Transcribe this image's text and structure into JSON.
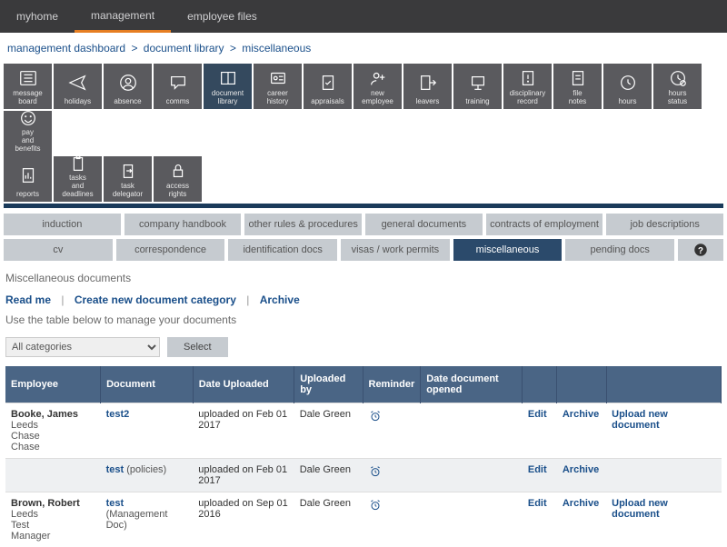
{
  "top_nav": {
    "items": [
      {
        "label": "myhome",
        "active": false
      },
      {
        "label": "management",
        "active": true
      },
      {
        "label": "employee files",
        "active": false
      }
    ]
  },
  "breadcrumb": {
    "parts": [
      "management dashboard",
      "document library",
      "miscellaneous"
    ]
  },
  "tiles": {
    "row1": [
      {
        "label": "message board",
        "icon": "list"
      },
      {
        "label": "holidays",
        "icon": "plane"
      },
      {
        "label": "absence",
        "icon": "user-circle"
      },
      {
        "label": "comms",
        "icon": "chat"
      },
      {
        "label": "document library",
        "icon": "book",
        "active": true
      },
      {
        "label": "career history",
        "icon": "id"
      },
      {
        "label": "appraisals",
        "icon": "check-doc"
      },
      {
        "label": "new employee",
        "icon": "user-plus"
      },
      {
        "label": "leavers",
        "icon": "exit"
      },
      {
        "label": "training",
        "icon": "board"
      },
      {
        "label": "disciplinary record",
        "icon": "warn-doc"
      },
      {
        "label": "file notes",
        "icon": "note"
      },
      {
        "label": "hours",
        "icon": "clock"
      },
      {
        "label": "hours status",
        "icon": "clock-status"
      },
      {
        "label": "pay and benefits",
        "icon": "smile"
      }
    ],
    "row2": [
      {
        "label": "reports",
        "icon": "report"
      },
      {
        "label": "tasks and deadlines",
        "icon": "clipboard"
      },
      {
        "label": "task delegator",
        "icon": "delegate"
      },
      {
        "label": "access rights",
        "icon": "lock"
      }
    ]
  },
  "categories": {
    "row1": [
      "induction",
      "company handbook",
      "other rules & procedures",
      "general documents",
      "contracts of employment",
      "job descriptions"
    ],
    "row2": [
      "cv",
      "correspondence",
      "identification docs",
      "visas / work permits",
      "miscellaneous",
      "pending docs"
    ],
    "active": "miscellaneous"
  },
  "section": {
    "title": "Miscellaneous documents",
    "actions": {
      "readme": "Read me",
      "create": "Create new document category",
      "archive": "Archive"
    },
    "hint": "Use the table below to manage your documents"
  },
  "filter": {
    "select_label": "All categories",
    "button": "Select"
  },
  "table": {
    "headers": [
      "Employee",
      "Document",
      "Date Uploaded",
      "Uploaded by",
      "Reminder",
      "Date document opened",
      "",
      "",
      ""
    ],
    "rows": [
      {
        "employee_name": "Booke, James",
        "employee_lines": [
          "Leeds",
          "Chase",
          "Chase"
        ],
        "document": "test2",
        "document_suffix": "",
        "date_uploaded": "uploaded on Feb 01 2017",
        "uploaded_by": "Dale Green",
        "reminder": true,
        "opened": "",
        "edit": "Edit",
        "archive": "Archive",
        "upload": "Upload new document",
        "alt": false
      },
      {
        "employee_name": "",
        "employee_lines": [],
        "document": "test",
        "document_suffix": " (policies)",
        "date_uploaded": "uploaded on Feb 01 2017",
        "uploaded_by": "Dale Green",
        "reminder": true,
        "opened": "",
        "edit": "Edit",
        "archive": "Archive",
        "upload": "",
        "alt": true
      },
      {
        "employee_name": "Brown, Robert",
        "employee_lines": [
          "Leeds",
          "Test",
          "Manager"
        ],
        "document": "test",
        "document_suffix": " (Management Doc)",
        "date_uploaded": "uploaded on Sep 01 2016",
        "uploaded_by": "Dale Green",
        "reminder": true,
        "opened": "",
        "edit": "Edit",
        "archive": "Archive",
        "upload": "Upload new document",
        "alt": false
      }
    ]
  }
}
